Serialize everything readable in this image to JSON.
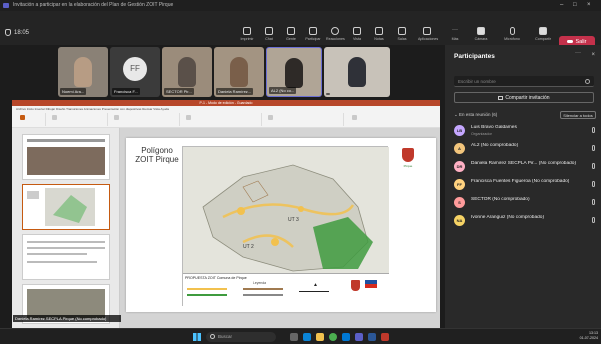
{
  "window": {
    "title": "Invitación a participar en la elaboración del Plan de Gestión ZOIT Pirque"
  },
  "toolbar": {
    "timer": "18:05",
    "buttons": [
      {
        "label": "Imprimir"
      },
      {
        "label": "Chat"
      },
      {
        "label": "Gente"
      },
      {
        "label": "Participar"
      },
      {
        "label": "Reacciones"
      },
      {
        "label": "Vista"
      },
      {
        "label": "Notas"
      },
      {
        "label": "Salas"
      },
      {
        "label": "Aplicaciones"
      },
      {
        "label": "Más"
      },
      {
        "label": "Cámara"
      },
      {
        "label": "Micrófono"
      },
      {
        "label": "Compartir"
      }
    ],
    "leave_label": "Salir"
  },
  "video_strip": [
    {
      "name": "Noemí Ara..."
    },
    {
      "name": "Francisca F...",
      "initials": "FF"
    },
    {
      "name": "SECTOR Pir..."
    },
    {
      "name": "Daniela Ramírez..."
    },
    {
      "name": "AL2 (No co..."
    },
    {
      "name": ""
    }
  ],
  "presentation": {
    "window_title": "P-1 - Modo de edición - Guardado",
    "ribbon_tabs": "Archivo   Inicio   Insertar   Dibujar   Diseño   Transiciones   Animaciones   Presentación con diapositivas   Revisar   Vista   Ayuda",
    "slide_title": "Polígono ZOIT Pirque",
    "map_labels": {
      "ut3": "UT 3",
      "ut2": "UT 2"
    },
    "legend_title": "PROPUESTA ZOIT Comuna de Pirque",
    "legend_sub": "Leyenda",
    "crest_text": "Pirque",
    "presenter_tag": "Daniela Ramírez SECPLA Pirque (No comprobado)"
  },
  "participants_panel": {
    "title": "Participantes",
    "search_placeholder": "Escribir un nombre",
    "share_invite_label": "Compartir invitación",
    "section_label": "En esta reunión (6)",
    "mute_all_label": "Silenciar a todos",
    "people": [
      {
        "initials": "LB",
        "name": "Luis Bravo Galdames",
        "sub": "Organizador",
        "color": "#c5a7ff"
      },
      {
        "initials": "A",
        "name": "AL2 (No comprobado)",
        "sub": "",
        "color": "#f2c57c"
      },
      {
        "initials": "DR",
        "name": "Daniela Ramirez SECPLA Pir... (No comprobado)",
        "sub": "",
        "color": "#ffb0c4"
      },
      {
        "initials": "FF",
        "name": "Francisca Fuentes Figueroa (No comprobado)",
        "sub": "",
        "color": "#ffd27f"
      },
      {
        "initials": "S",
        "name": "SECTOR (No comprobado)",
        "sub": "",
        "color": "#ff9b9b"
      },
      {
        "initials": "NA",
        "name": "Ivonne Aranguiz (No comprobado)",
        "sub": "",
        "color": "#f6d365"
      }
    ]
  },
  "taskbar": {
    "search_placeholder": "Buscar",
    "time": "13:13",
    "date": "01-07-2024"
  },
  "colors": {
    "leave": "#c4314b",
    "accent": "#5b5fc7",
    "ppt": "#b7472a"
  }
}
